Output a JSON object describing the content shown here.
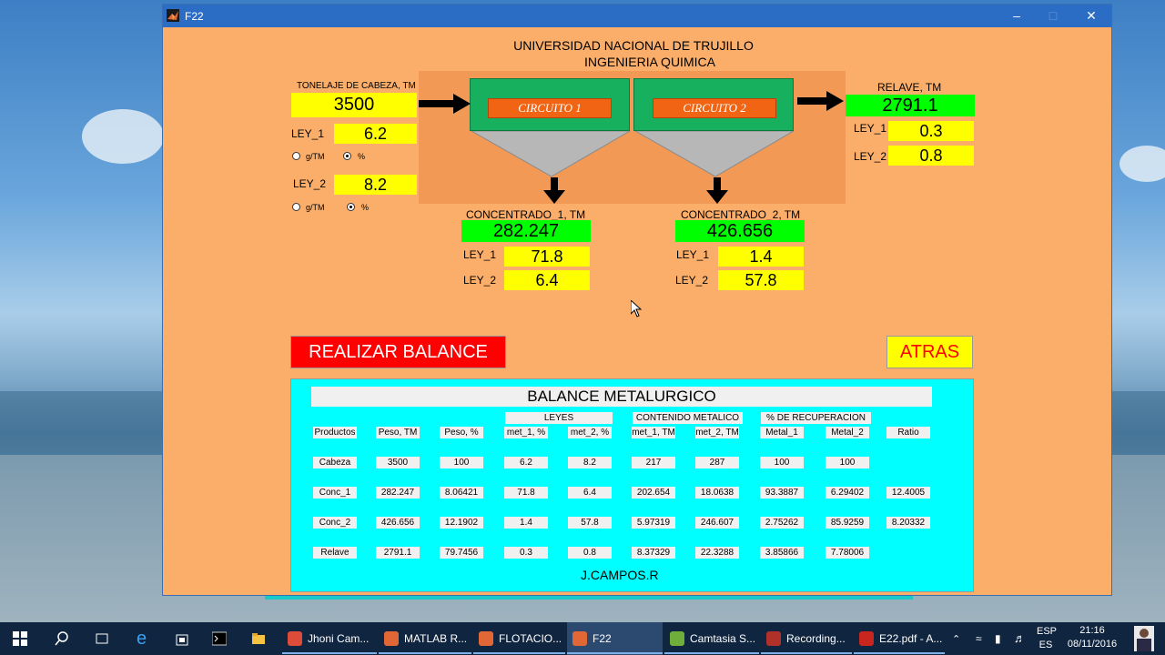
{
  "window": {
    "title": "F22"
  },
  "header": {
    "line1": "UNIVERSIDAD NACIONAL DE TRUJILLO",
    "line2": "INGENIERIA QUIMICA"
  },
  "feed": {
    "label": "TONELAJE DE CABEZA, TM",
    "value": "3500",
    "ley1_label": "LEY_1",
    "ley1": "6.2",
    "ley2_label": "LEY_2",
    "ley2": "8.2",
    "radio1": {
      "opt_a": "g/TM",
      "opt_b": "%",
      "selected": "%"
    },
    "radio2": {
      "opt_a": "g/TM",
      "opt_b": "%",
      "selected": "%"
    }
  },
  "circuits": {
    "c1": "CIRCUITO 1",
    "c2": "CIRCUITO 2"
  },
  "relave": {
    "label": "RELAVE, TM",
    "value": "2791.1",
    "ley1_label": "LEY_1",
    "ley1": "0.3",
    "ley2_label": "LEY_2",
    "ley2": "0.8"
  },
  "conc1": {
    "label": "CONCENTRADO_1, TM",
    "value": "282.247",
    "ley1_label": "LEY_1",
    "ley1": "71.8",
    "ley2_label": "LEY_2",
    "ley2": "6.4"
  },
  "conc2": {
    "label": "CONCENTRADO_2, TM",
    "value": "426.656",
    "ley1_label": "LEY_1",
    "ley1": "1.4",
    "ley2_label": "LEY_2",
    "ley2": "57.8"
  },
  "buttons": {
    "balance": "REALIZAR BALANCE",
    "back": "ATRAS"
  },
  "table": {
    "title": "BALANCE METALURGICO",
    "groups": {
      "leyes": "LEYES",
      "contenido": "CONTENIDO METALICO",
      "recuperacion": "% DE RECUPERACION"
    },
    "headers": [
      "Productos",
      "Peso, TM",
      "Peso, %",
      "met_1, %",
      "met_2, %",
      "met_1, TM",
      "met_2, TM",
      "Metal_1",
      "Metal_2",
      "Ratio"
    ],
    "rows": [
      [
        "Cabeza",
        "3500",
        "100",
        "6.2",
        "8.2",
        "217",
        "287",
        "100",
        "100",
        ""
      ],
      [
        "Conc_1",
        "282.247",
        "8.06421",
        "71.8",
        "6.4",
        "202.654",
        "18.0638",
        "93.3887",
        "6.29402",
        "12.4005"
      ],
      [
        "Conc_2",
        "426.656",
        "12.1902",
        "1.4",
        "57.8",
        "5.97319",
        "246.607",
        "2.75262",
        "85.9259",
        "8.20332"
      ],
      [
        "Relave",
        "2791.1",
        "79.7456",
        "0.3",
        "0.8",
        "8.37329",
        "22.3288",
        "3.85866",
        "7.78006",
        ""
      ]
    ],
    "author": "J.CAMPOS.R"
  },
  "taskbar": {
    "apps": [
      {
        "label": "Jhoni Cam..."
      },
      {
        "label": "MATLAB R..."
      },
      {
        "label": "FLOTACIO..."
      },
      {
        "label": "F22"
      },
      {
        "label": "Camtasia S..."
      },
      {
        "label": "Recording..."
      },
      {
        "label": "E22.pdf - A..."
      }
    ],
    "lang1": "ESP",
    "lang2": "ES",
    "time": "21:16",
    "date": "08/11/2016"
  }
}
